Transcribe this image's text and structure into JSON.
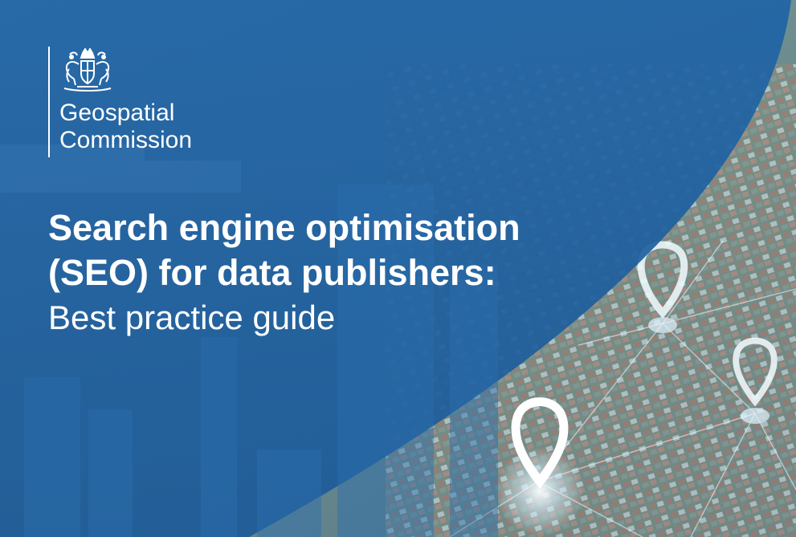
{
  "organisation": {
    "name_lines": [
      "Geospatial",
      "Commission"
    ],
    "crest_icon": "royal-coat-of-arms"
  },
  "title": {
    "lines": [
      "Search engine optimisation",
      "(SEO) for data publishers:"
    ],
    "subtitle": "Best practice guide"
  },
  "colors": {
    "brand_blue": "#1d5d9b",
    "text": "#ffffff"
  },
  "background": {
    "photo_subject": "aerial-city-with-location-pins-icon"
  }
}
